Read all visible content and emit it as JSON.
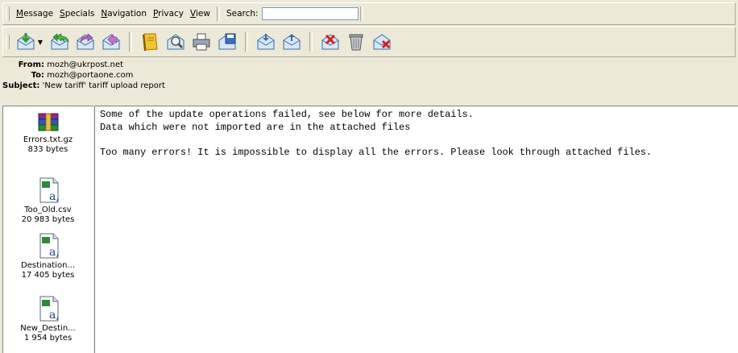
{
  "menubar": {
    "items": [
      {
        "label": "Message",
        "underline": "M",
        "rest": "essage"
      },
      {
        "label": "Specials",
        "underline": "S",
        "rest": "pecials"
      },
      {
        "label": "Navigation",
        "underline": "N",
        "rest": "avigation"
      },
      {
        "label": "Privacy",
        "underline": "P",
        "rest": "rivacy"
      },
      {
        "label": "View",
        "underline": "V",
        "rest": "iew"
      }
    ],
    "search_label": "Search:",
    "search_value": ""
  },
  "toolbar": {
    "buttons": [
      "get-mail",
      "reply-all",
      "forward",
      "redirect",
      "address-book",
      "find",
      "print",
      "save",
      "move-in",
      "move-out",
      "delete-red",
      "trash",
      "delete-x"
    ]
  },
  "header": {
    "from_label": "From:",
    "from_value": "mozh@ukrpost.net",
    "to_label": "To:",
    "to_value": "mozh@portaone.com",
    "subject_label": "Subject:",
    "subject_value": "'New tariff' tariff upload report"
  },
  "attachments": [
    {
      "name": "Errors.txt.gz",
      "size": "833 bytes",
      "icon": "archive-icon"
    },
    {
      "name": "Too_Old.csv",
      "size": "20 983 bytes",
      "icon": "excel-icon"
    },
    {
      "name": "Destination...",
      "size": "17 405 bytes",
      "icon": "excel-icon"
    },
    {
      "name": "New_Destin...",
      "size": "1 954 bytes",
      "icon": "excel-icon"
    }
  ],
  "message": {
    "line1": "Some of the update operations failed, see below for more details.",
    "line2": "Data which were not imported are in the attached files",
    "line3": "",
    "line4": "Too many errors! It is impossible to display all the errors. Please look through attached files."
  }
}
